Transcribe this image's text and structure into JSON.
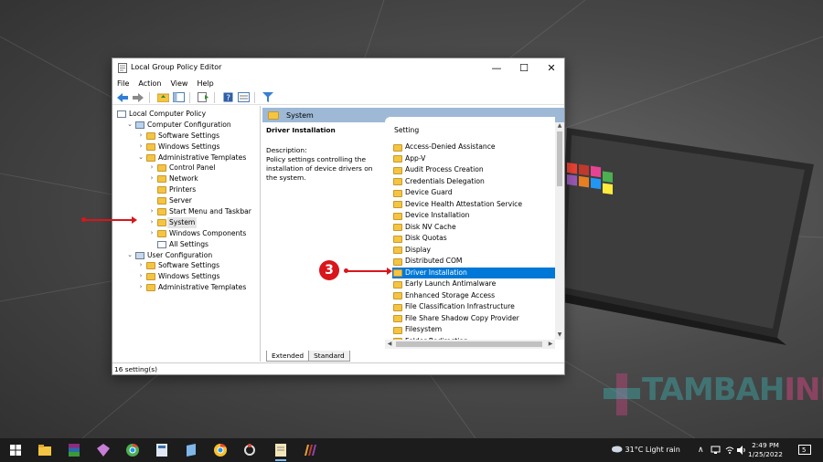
{
  "window": {
    "title": "Local Group Policy Editor",
    "minimize": "—",
    "maximize": "☐",
    "close": "✕"
  },
  "menu": [
    "File",
    "Action",
    "View",
    "Help"
  ],
  "tree": [
    {
      "label": "Local Computer Policy",
      "level": 0,
      "chevron": "",
      "icon": "policy-icon"
    },
    {
      "label": "Computer Configuration",
      "level": 1,
      "chevron": "⌄",
      "icon": "computer-icon"
    },
    {
      "label": "Software Settings",
      "level": 2,
      "chevron": "›",
      "icon": "folder-icon"
    },
    {
      "label": "Windows Settings",
      "level": 2,
      "chevron": "›",
      "icon": "folder-icon"
    },
    {
      "label": "Administrative Templates",
      "level": 2,
      "chevron": "⌄",
      "icon": "folder-icon"
    },
    {
      "label": "Control Panel",
      "level": 3,
      "chevron": "›",
      "icon": "folder-icon"
    },
    {
      "label": "Network",
      "level": 3,
      "chevron": "›",
      "icon": "folder-icon"
    },
    {
      "label": "Printers",
      "level": 3,
      "chevron": "",
      "icon": "folder-icon"
    },
    {
      "label": "Server",
      "level": 3,
      "chevron": "",
      "icon": "folder-icon"
    },
    {
      "label": "Start Menu and Taskbar",
      "level": 3,
      "chevron": "›",
      "icon": "folder-icon"
    },
    {
      "label": "System",
      "level": 3,
      "chevron": "›",
      "icon": "folder-icon",
      "selected": true
    },
    {
      "label": "Windows Components",
      "level": 3,
      "chevron": "›",
      "icon": "folder-icon"
    },
    {
      "label": "All Settings",
      "level": 3,
      "chevron": "",
      "icon": "settings-page-icon"
    },
    {
      "label": "User Configuration",
      "level": 1,
      "chevron": "⌄",
      "icon": "user-icon"
    },
    {
      "label": "Software Settings",
      "level": 2,
      "chevron": "›",
      "icon": "folder-icon"
    },
    {
      "label": "Windows Settings",
      "level": 2,
      "chevron": "›",
      "icon": "folder-icon"
    },
    {
      "label": "Administrative Templates",
      "level": 2,
      "chevron": "›",
      "icon": "folder-icon"
    }
  ],
  "right_header": "System",
  "description": {
    "title": "Driver Installation",
    "heading": "Description:",
    "body": "Policy settings controlling the installation of device drivers on the system."
  },
  "list": {
    "column": "Setting",
    "items": [
      "Access-Denied Assistance",
      "App-V",
      "Audit Process Creation",
      "Credentials Delegation",
      "Device Guard",
      "Device Health Attestation Service",
      "Device Installation",
      "Disk NV Cache",
      "Disk Quotas",
      "Display",
      "Distributed COM",
      "Driver Installation",
      "Early Launch Antimalware",
      "Enhanced Storage Access",
      "File Classification Infrastructure",
      "File Share Shadow Copy Provider",
      "Filesystem",
      "Folder Redirection"
    ],
    "selected_index": 11
  },
  "tabs": [
    "Extended",
    "Standard"
  ],
  "status": "16 setting(s)",
  "annotation": {
    "step": "3"
  },
  "taskbar": {
    "weather": "31°C  Light rain",
    "time": "2:49 PM",
    "date": "1/25/2022",
    "notifications": "5"
  },
  "watermark": {
    "part1": "TAMBAH",
    "part2": "INFO"
  },
  "colors": {
    "selection": "#0078d7",
    "header": "#9db9d6",
    "annotation": "#d8161b",
    "folder": "#f4c542"
  }
}
